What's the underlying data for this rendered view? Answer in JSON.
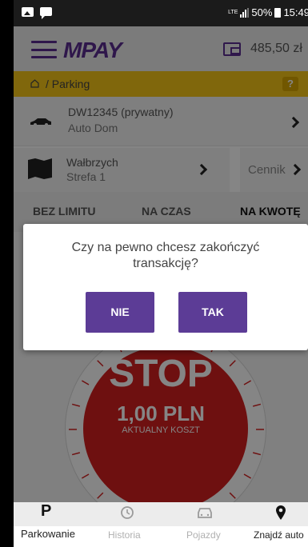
{
  "status_bar": {
    "network": "LTE",
    "battery": "50%",
    "time": "15:49"
  },
  "app_bar": {
    "logo": "MPAY",
    "balance": "485,50 zł"
  },
  "breadcrumb": {
    "home": "⌂",
    "separator": "/",
    "current": "Parking",
    "help": "?"
  },
  "vehicle": {
    "name": "DW12345 (prywatny)",
    "model": "Auto Dom"
  },
  "zone": {
    "city": "Wałbrzych",
    "zone": "Strefa 1",
    "price_label": "Cennik"
  },
  "tabs": [
    {
      "label": "BEZ LIMITU",
      "active": false
    },
    {
      "label": "NA CZAS",
      "active": false
    },
    {
      "label": "NA KWOTĘ",
      "active": true
    }
  ],
  "stop": {
    "label": "STOP",
    "amount": "1,00 PLN",
    "amount_caption": "AKTUALNY KOSZT"
  },
  "dialog": {
    "message_line1": "Czy na pewno chcesz zakończyć",
    "message_line2": "transakcję?",
    "no_label": "NIE",
    "yes_label": "TAK"
  },
  "bottom_nav": [
    {
      "label": "Parkowanie",
      "icon": "parking-icon",
      "active": true
    },
    {
      "label": "Historia",
      "icon": "history-icon",
      "active": false
    },
    {
      "label": "Pojazdy",
      "icon": "car-icon",
      "active": false
    },
    {
      "label": "Znajdź auto",
      "icon": "location-pin-icon",
      "active": true
    }
  ],
  "colors": {
    "brand": "#5a2d91",
    "accent": "#f5c518",
    "stop": "#d4201f",
    "button": "#5c3c96"
  }
}
